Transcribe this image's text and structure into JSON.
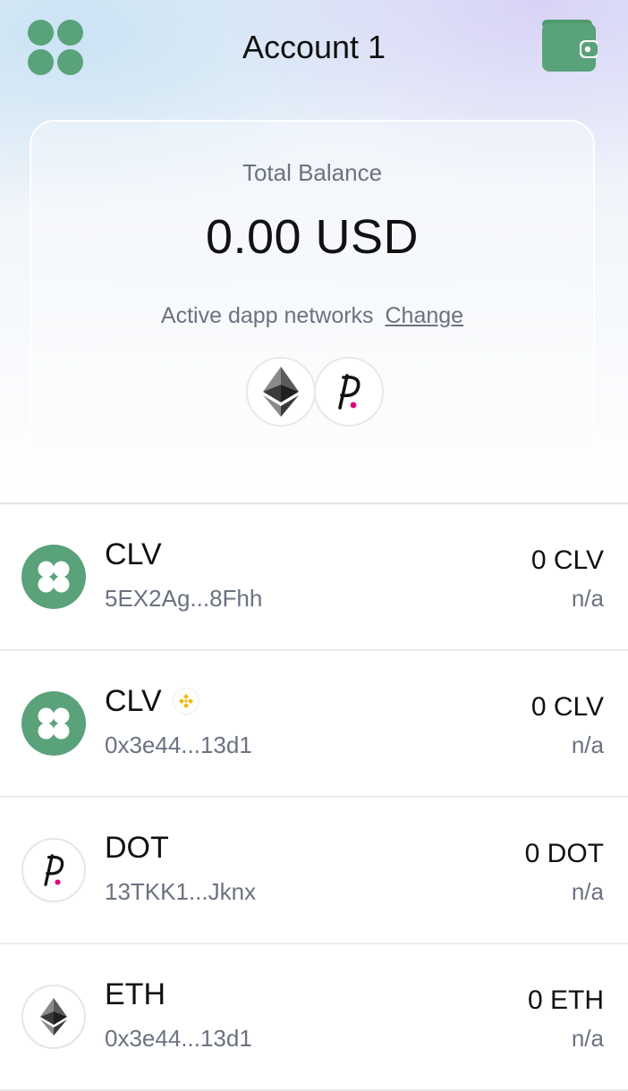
{
  "header": {
    "logo_icon": "clover-logo-icon",
    "title": "Account 1",
    "wallet_icon": "wallet-icon"
  },
  "balance": {
    "label": "Total Balance",
    "value": "0.00 USD",
    "networks_label": "Active dapp networks",
    "change_label": "Change",
    "network_icons": [
      "ethereum-icon",
      "polkadot-icon"
    ]
  },
  "assets": [
    {
      "name": "CLV",
      "address": "5EX2Ag...8Fhh",
      "amount": "0 CLV",
      "fiat": "n/a",
      "icon": "clover-icon",
      "badge": ""
    },
    {
      "name": "CLV",
      "address": "0x3e44...13d1",
      "amount": "0 CLV",
      "fiat": "n/a",
      "icon": "clover-icon",
      "badge": "bnb-chain-icon"
    },
    {
      "name": "DOT",
      "address": "13TKK1...Jknx",
      "amount": "0 DOT",
      "fiat": "n/a",
      "icon": "polkadot-icon",
      "badge": ""
    },
    {
      "name": "ETH",
      "address": "0x3e44...13d1",
      "amount": "0 ETH",
      "fiat": "n/a",
      "icon": "ethereum-icon",
      "badge": ""
    }
  ],
  "colors": {
    "brand_green": "#5aa27a",
    "polkadot_pink": "#e6007a",
    "bnb_yellow": "#f0b90b"
  }
}
